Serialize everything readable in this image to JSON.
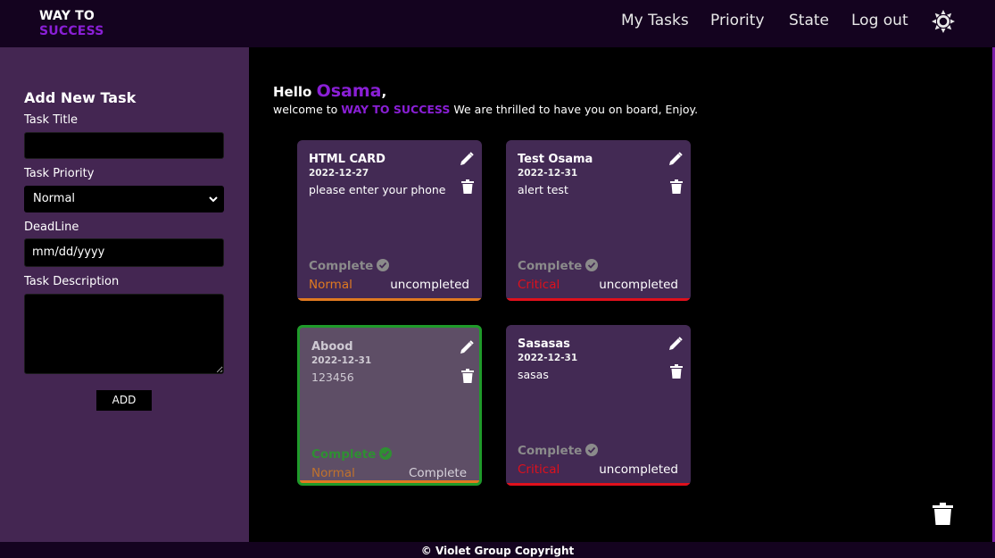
{
  "brand": {
    "line1": "WAY TO",
    "line2": "SUCCESS"
  },
  "nav": {
    "my_tasks": "My Tasks",
    "priority": "Priority",
    "state": "State",
    "logout": "Log out",
    "theme_icon": "sun-icon"
  },
  "sidebar": {
    "title": "Add New Task",
    "task_title_label": "Task Title",
    "task_title_value": "",
    "priority_label": "Task Priority",
    "priority_selected": "Normal",
    "deadline_label": "DeadLine",
    "deadline_placeholder": "mm/dd/yyyy",
    "description_label": "Task Description",
    "description_value": "",
    "add_label": "ADD"
  },
  "greeting": {
    "hello": "Hello",
    "name": "Osama",
    "comma": ",",
    "welcome_prefix": "welcome to",
    "welcome_brand": "WAY TO SUCCESS",
    "welcome_suffix": "We are thrilled to have you on board, Enjoy."
  },
  "colors": {
    "accent": "#8a1fd6",
    "normal": "#e07a20",
    "critical": "#e0101c",
    "completed_border": "#1f9a2a"
  },
  "tasks": [
    {
      "title": "HTML CARD",
      "date": "2022-12-27",
      "description": "please enter your phone",
      "complete_label": "Complete",
      "priority": "Normal",
      "status": "uncompleted"
    },
    {
      "title": "Test Osama",
      "date": "2022-12-31",
      "description": "alert test",
      "complete_label": "Complete",
      "priority": "Critical",
      "status": "uncompleted"
    },
    {
      "title": "Abood",
      "date": "2022-12-31",
      "description": "123456",
      "complete_label": "Complete",
      "priority": "Normal",
      "status": "Complete"
    },
    {
      "title": "Sasasas",
      "date": "2022-12-31",
      "description": "sasas",
      "complete_label": "Complete",
      "priority": "Critical",
      "status": "uncompleted"
    }
  ],
  "footer": {
    "text": "© Violet Group Copyright"
  }
}
